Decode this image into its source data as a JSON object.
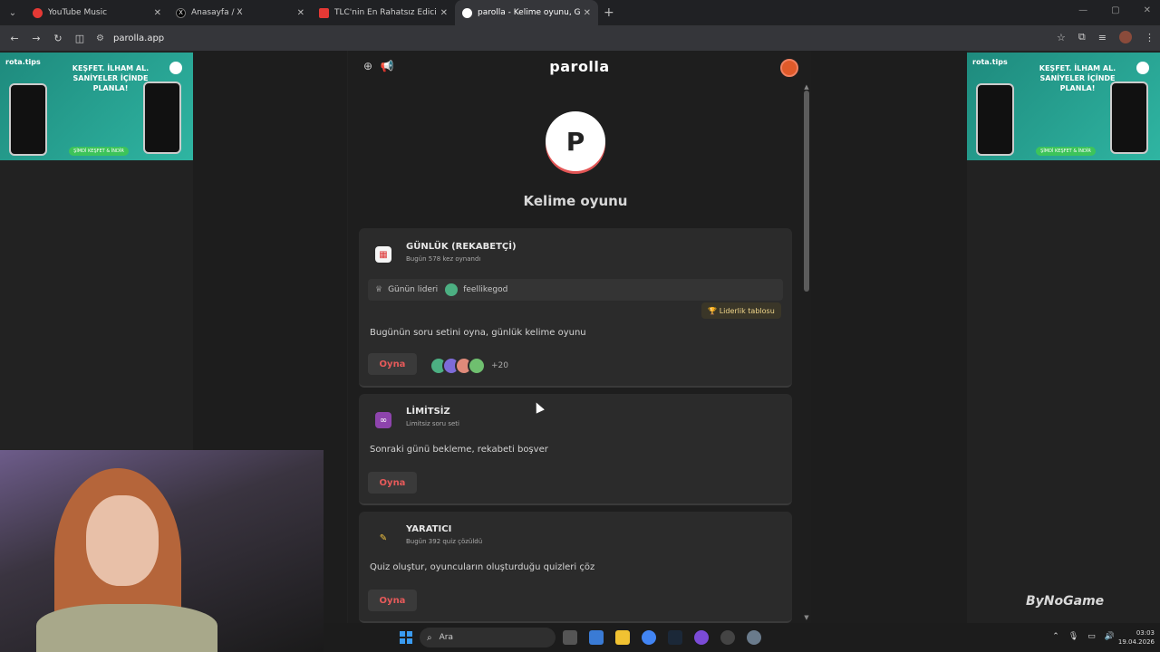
{
  "browser": {
    "tabs": [
      {
        "title": "YouTube Music",
        "color": "#e53935",
        "active": false
      },
      {
        "title": "Anasayfa / X",
        "color": "#000000",
        "active": false
      },
      {
        "title": "TLC'nin En Rahatsız Edici Progr",
        "color": "#e53935",
        "active": false
      },
      {
        "title": "parolla - Kelime oyunu, Günlük",
        "color": "#ffffff",
        "active": true
      }
    ],
    "url": "parolla.app"
  },
  "ads": {
    "brand": "rota.tips",
    "headline": "KEŞFET. İLHAM AL. SANİYELER İÇİNDE PLANLA!",
    "cta": "ŞİMDİ KEŞFET & İNDİR"
  },
  "app": {
    "logo": "parolla",
    "badge_letter": "P",
    "subtitle": "Kelime oyunu",
    "accent": "#e65a5a"
  },
  "cards": {
    "daily": {
      "title": "GÜNLÜK (REKABETÇİ)",
      "sub": "Bugün 578 kez oynandı",
      "leader_label": "Günün lideri",
      "leader_name": "feellikegod",
      "board_label": "🏆 Liderlik tablosu",
      "desc": "Bugünün soru setini oyna, günlük kelime oyunu",
      "play": "Oyna",
      "more_players": "+20"
    },
    "unlimited": {
      "title": "LİMİTSİZ",
      "sub": "Limitsiz soru seti",
      "desc": "Sonraki günü bekleme, rekabeti boşver",
      "play": "Oyna"
    },
    "creator": {
      "title": "YARATICI",
      "sub": "Bugün 392 quiz çözüldü",
      "desc": "Quiz oluştur, oyuncuların oluşturduğu quizleri çöz",
      "play": "Oyna"
    }
  },
  "watermark": "ByNoGame",
  "taskbar": {
    "search_placeholder": "Ara",
    "time": "03:03",
    "date": "19.04.2026"
  }
}
